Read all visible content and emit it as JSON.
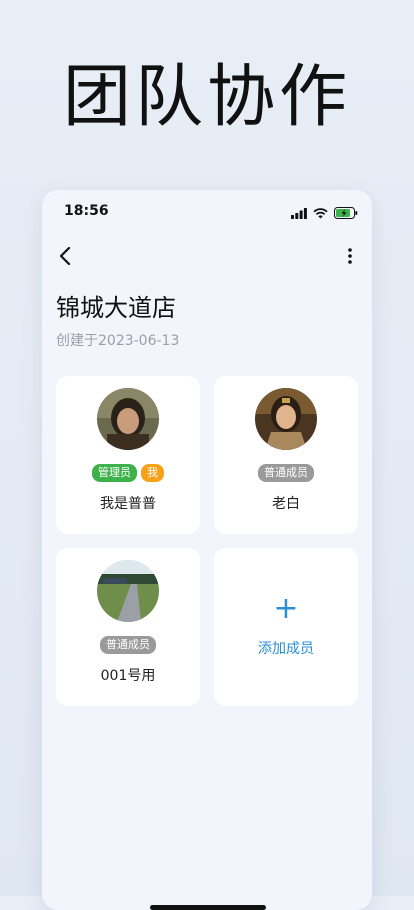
{
  "hero": {
    "title": "团队协作"
  },
  "status": {
    "time": "18:56"
  },
  "store": {
    "name": "锦城大道店",
    "created": "创建于2023-06-13"
  },
  "members": [
    {
      "name": "我是普普",
      "badges": [
        "管理员",
        "我"
      ]
    },
    {
      "name": "老白",
      "badges": [
        "普通成员"
      ]
    },
    {
      "name": "001号用",
      "badges": [
        "普通成员"
      ]
    }
  ],
  "add_card": {
    "plus": "+",
    "label": "添加成员"
  },
  "icons": {
    "back": "chevron-left-icon",
    "more": "more-vertical-icon",
    "signal": "signal-icon",
    "wifi": "wifi-icon",
    "battery": "battery-charging-icon"
  },
  "colors": {
    "admin_badge": "#3db24a",
    "me_badge": "#f5a11a",
    "normal_badge": "#9a9a9a",
    "accent": "#2a8fd6"
  }
}
